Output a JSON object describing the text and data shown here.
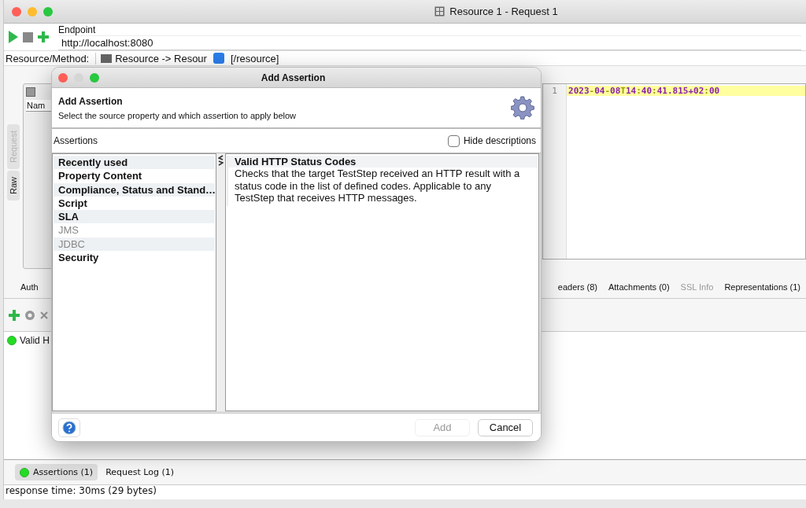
{
  "window": {
    "title": "Resource 1 - Request 1"
  },
  "toolbar": {
    "endpoint_label": "Endpoint",
    "endpoint": "http://localhost:8080"
  },
  "resource_row": {
    "label": "Resource/Method:",
    "resource": "Resource -> Resour",
    "path": "[/resource]"
  },
  "request_panel": {
    "side_tabs": [
      {
        "label": "Request",
        "disabled": true
      },
      {
        "label": "Raw",
        "disabled": false
      }
    ],
    "column_1": "Nam"
  },
  "response_panel": {
    "lines": [
      {
        "number": "1",
        "text": "2023-04-08T14:40:41.815+02:00"
      }
    ]
  },
  "detail_tabs": {
    "left": [
      {
        "label": "Auth",
        "disabled": false
      }
    ],
    "right": [
      {
        "label": "eaders (8)",
        "disabled": false
      },
      {
        "label": "Attachments (0)",
        "disabled": false
      },
      {
        "label": "SSL Info",
        "disabled": true
      },
      {
        "label": "Representations (1)",
        "disabled": false
      }
    ]
  },
  "assertions": [
    {
      "name": "Valid H",
      "color": "#22dd22"
    }
  ],
  "bottom_tabs": [
    {
      "label": "Assertions (1)",
      "selected": true,
      "color": "#22dd22"
    },
    {
      "label": "Request Log (1)",
      "selected": false
    }
  ],
  "status_bar": "response time: 30ms (29 bytes)",
  "dialog": {
    "title": "Add Assertion",
    "heading": "Add Assertion",
    "subheading": "Select the source property and which assertion to apply below",
    "list_label": "Assertions",
    "hide_descriptions": {
      "label": "Hide descriptions",
      "checked": false
    },
    "categories": [
      {
        "label": "Recently used",
        "disabled": false
      },
      {
        "label": "Property Content",
        "disabled": false
      },
      {
        "label": "Compliance, Status and Stand…",
        "disabled": false
      },
      {
        "label": "Script",
        "disabled": false
      },
      {
        "label": "SLA",
        "disabled": false
      },
      {
        "label": "JMS",
        "disabled": true
      },
      {
        "label": "JDBC",
        "disabled": true
      },
      {
        "label": "Security",
        "disabled": false
      }
    ],
    "assertions": [
      {
        "title": "Valid HTTP Status Codes",
        "description": "Checks that the target TestStep received an HTTP result with a status code in the list of defined codes. Applicable to any TestStep that receives HTTP messages."
      }
    ],
    "buttons": [
      {
        "label": "Add",
        "disabled": true
      },
      {
        "label": "Cancel",
        "disabled": false
      }
    ]
  }
}
